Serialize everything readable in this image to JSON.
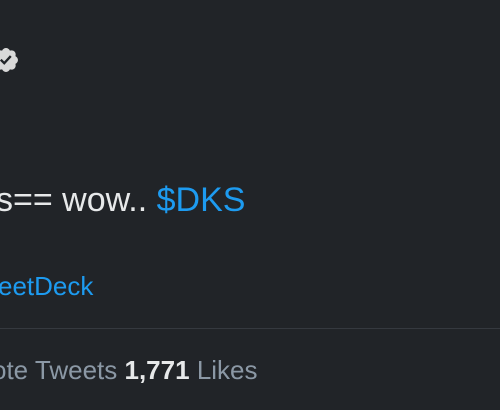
{
  "tweet": {
    "text": "s== wow.. ",
    "cashtag": "$DKS",
    "source": "eetDeck"
  },
  "stats": {
    "quote_tweets_label": "ote Tweets",
    "likes_count": "1,771",
    "likes_label": "Likes"
  },
  "colors": {
    "background": "#212428",
    "text": "#e7e9ea",
    "accent": "#1d9bf0",
    "muted": "#8b98a5",
    "divider": "#35393f"
  },
  "icons": {
    "verified": "verified-badge-icon"
  }
}
